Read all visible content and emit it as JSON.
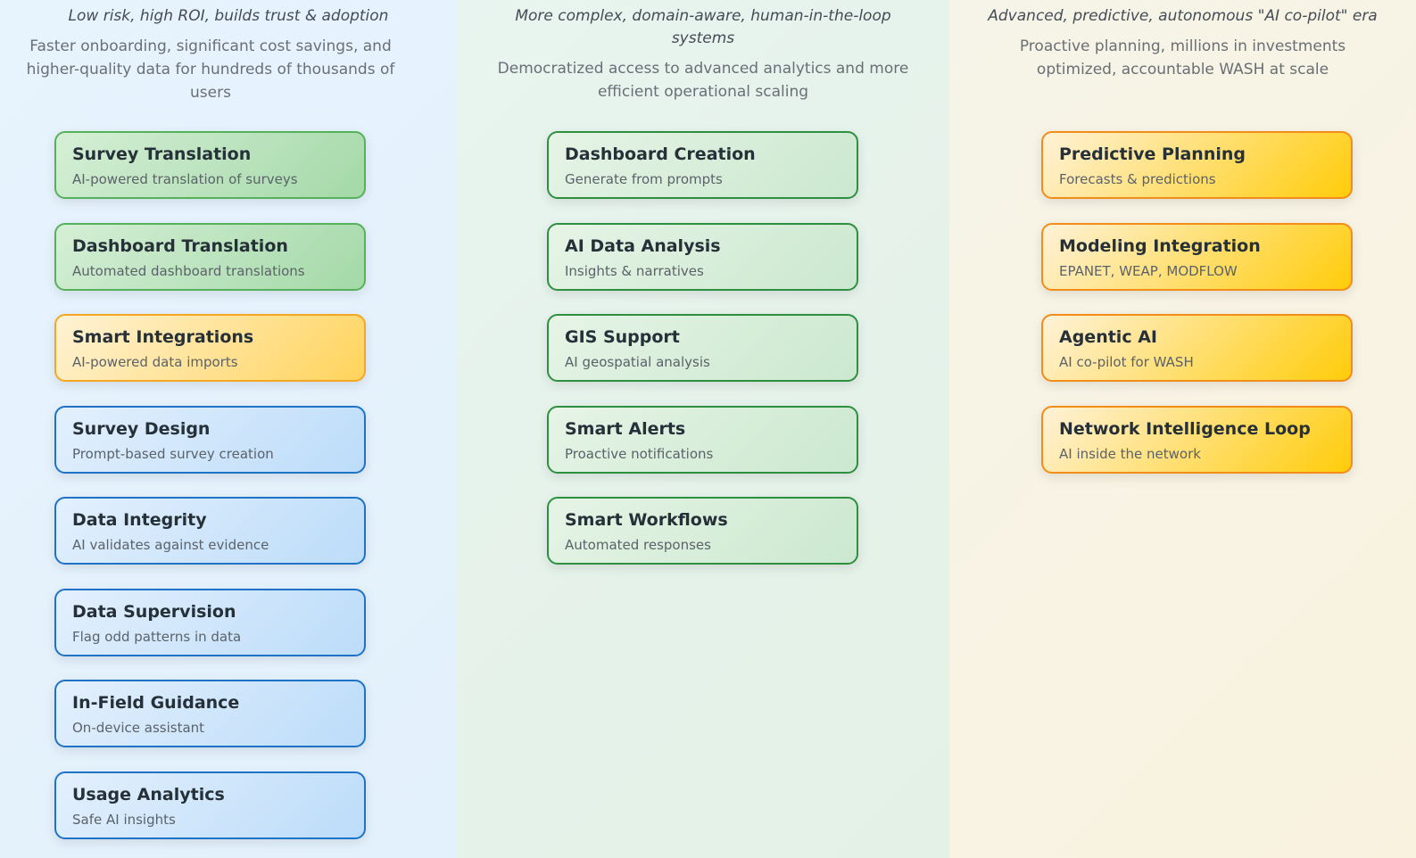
{
  "columns": [
    {
      "tagline": "Low risk, high ROI, builds trust & adoption",
      "summary": "Faster onboarding, significant cost savings, and higher-quality data for hundreds of thousands of users",
      "cards": [
        {
          "title": "Survey Translation",
          "desc": "AI-powered translation of surveys",
          "style": "green"
        },
        {
          "title": "Dashboard Translation",
          "desc": "Automated dashboard translations",
          "style": "green"
        },
        {
          "title": "Smart Integrations",
          "desc": "AI-powered data imports",
          "style": "yellow"
        },
        {
          "title": "Survey Design",
          "desc": "Prompt-based survey creation",
          "style": "blue"
        },
        {
          "title": "Data Integrity",
          "desc": "AI validates against evidence",
          "style": "blue"
        },
        {
          "title": "Data Supervision",
          "desc": "Flag odd patterns in data",
          "style": "blue"
        },
        {
          "title": "In-Field Guidance",
          "desc": "On-device assistant",
          "style": "blue"
        },
        {
          "title": "Usage Analytics",
          "desc": "Safe AI insights",
          "style": "blue"
        }
      ]
    },
    {
      "tagline": "More complex, domain-aware, human-in-the-loop systems",
      "summary": "Democratized access to advanced analytics and more efficient operational scaling",
      "cards": [
        {
          "title": "Dashboard Creation",
          "desc": "Generate from prompts",
          "style": "green-light"
        },
        {
          "title": "AI Data Analysis",
          "desc": "Insights & narratives",
          "style": "green-light"
        },
        {
          "title": "GIS Support",
          "desc": "AI geospatial analysis",
          "style": "green-light"
        },
        {
          "title": "Smart Alerts",
          "desc": "Proactive notifications",
          "style": "green-light"
        },
        {
          "title": "Smart Workflows",
          "desc": "Automated responses",
          "style": "green-light"
        }
      ]
    },
    {
      "tagline": "Advanced, predictive, autonomous \"AI co-pilot\" era",
      "summary": "Proactive planning, millions in investments optimized, accountable WASH at scale",
      "cards": [
        {
          "title": "Predictive Planning",
          "desc": "Forecasts & predictions",
          "style": "orange"
        },
        {
          "title": "Modeling Integration",
          "desc": "EPANET, WEAP, MODFLOW",
          "style": "orange"
        },
        {
          "title": "Agentic AI",
          "desc": "AI co-pilot for WASH",
          "style": "orange"
        },
        {
          "title": "Network Intelligence Loop",
          "desc": "AI inside the network",
          "style": "orange"
        }
      ]
    }
  ]
}
